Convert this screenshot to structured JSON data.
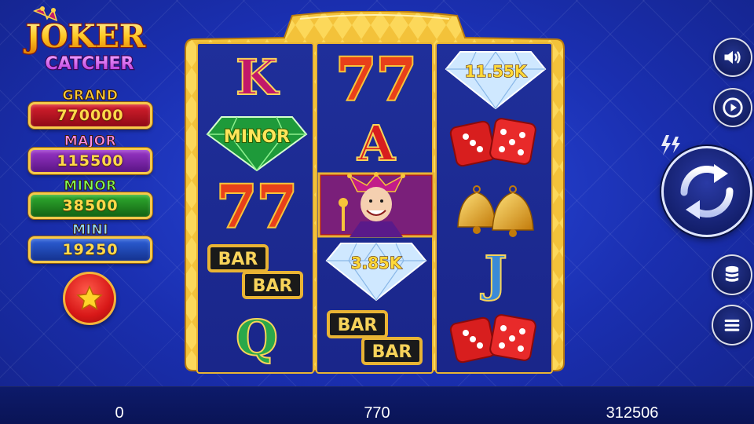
{
  "logo": {
    "line1": "JOKER",
    "line2": "CATCHER"
  },
  "jackpots": [
    {
      "label": "GRAND",
      "value": "770000",
      "label_color": "#ffcf3a",
      "box_color": "#b3121e"
    },
    {
      "label": "MAJOR",
      "value": "115500",
      "label_color": "#ff8ee8",
      "box_color": "#7a1fa8"
    },
    {
      "label": "MINOR",
      "value": "38500",
      "label_color": "#7dff5a",
      "box_color": "#1f8a1f"
    },
    {
      "label": "MINI",
      "value": "19250",
      "label_color": "#8ed8ff",
      "box_color": "#1f4bbb"
    }
  ],
  "favorite_button": {
    "icon": "star-icon"
  },
  "reels": [
    {
      "symbols": [
        {
          "type": "letter",
          "text": "K",
          "color": "#c2186a"
        },
        {
          "type": "gem",
          "gem": "green",
          "text": "MINOR"
        },
        {
          "type": "sevens",
          "text": "77"
        },
        {
          "type": "bar",
          "text": "BAR"
        },
        {
          "type": "letter",
          "text": "Q",
          "color": "#2aa84a"
        }
      ]
    },
    {
      "symbols": [
        {
          "type": "sevens",
          "text": "77"
        },
        {
          "type": "letter",
          "text": "A",
          "color": "#d81e1e"
        },
        {
          "type": "joker",
          "text": ""
        },
        {
          "type": "gem",
          "gem": "white",
          "text": "3.85K"
        },
        {
          "type": "bar",
          "text": "BAR"
        }
      ]
    },
    {
      "symbols": [
        {
          "type": "gem",
          "gem": "white",
          "text": "11.55K"
        },
        {
          "type": "dice"
        },
        {
          "type": "bells"
        },
        {
          "type": "letter",
          "text": "J",
          "color": "#3a8ad8"
        },
        {
          "type": "dice"
        }
      ]
    }
  ],
  "controls": {
    "sound": {
      "icon": "speaker-icon"
    },
    "autoplay": {
      "icon": "play-circle-icon"
    },
    "turbo": {
      "icon": "lightning-icon"
    },
    "spin": {
      "icon": "spin-arrows-icon"
    },
    "bet": {
      "icon": "coin-stack-icon"
    },
    "menu": {
      "icon": "hamburger-menu-icon"
    }
  },
  "bottom_bar": {
    "win": "0",
    "bet": "770",
    "balance": "312506"
  }
}
